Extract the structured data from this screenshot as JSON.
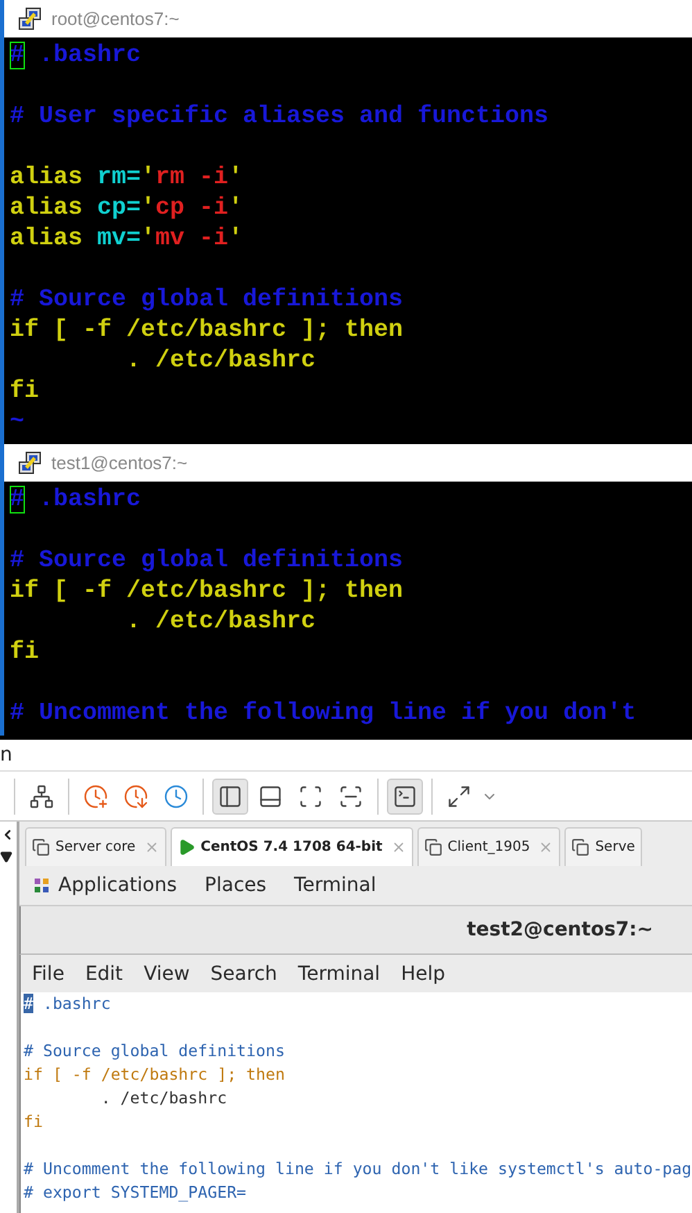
{
  "putty_windows": [
    {
      "title": "root@centos7:~",
      "lines": [
        {
          "kind": "code",
          "tokens": [
            {
              "kind": "cursor",
              "text": "#"
            },
            {
              "kind": "comment",
              "text": " .bashrc"
            }
          ]
        },
        {
          "kind": "blank"
        },
        {
          "kind": "code",
          "tokens": [
            {
              "kind": "comment",
              "text": "# User specific aliases and functions"
            }
          ]
        },
        {
          "kind": "blank"
        },
        {
          "kind": "code",
          "tokens": [
            {
              "kind": "keyword",
              "text": "alias "
            },
            {
              "kind": "variable",
              "text": "rm="
            },
            {
              "kind": "keyword",
              "text": "'"
            },
            {
              "kind": "string",
              "text": "rm -i"
            },
            {
              "kind": "keyword",
              "text": "'"
            }
          ]
        },
        {
          "kind": "code",
          "tokens": [
            {
              "kind": "keyword",
              "text": "alias "
            },
            {
              "kind": "variable",
              "text": "cp="
            },
            {
              "kind": "keyword",
              "text": "'"
            },
            {
              "kind": "string",
              "text": "cp -i"
            },
            {
              "kind": "keyword",
              "text": "'"
            }
          ]
        },
        {
          "kind": "code",
          "tokens": [
            {
              "kind": "keyword",
              "text": "alias "
            },
            {
              "kind": "variable",
              "text": "mv="
            },
            {
              "kind": "keyword",
              "text": "'"
            },
            {
              "kind": "string",
              "text": "mv -i"
            },
            {
              "kind": "keyword",
              "text": "'"
            }
          ]
        },
        {
          "kind": "blank"
        },
        {
          "kind": "code",
          "tokens": [
            {
              "kind": "comment",
              "text": "# Source global definitions"
            }
          ]
        },
        {
          "kind": "code",
          "tokens": [
            {
              "kind": "keyword",
              "text": "if [ -f /etc/bashrc ]; then"
            }
          ]
        },
        {
          "kind": "code",
          "tokens": [
            {
              "kind": "keyword",
              "text": "        . /etc/bashrc"
            }
          ]
        },
        {
          "kind": "code",
          "tokens": [
            {
              "kind": "keyword",
              "text": "fi"
            }
          ]
        },
        {
          "kind": "code",
          "tokens": [
            {
              "kind": "comment",
              "text": "~"
            }
          ]
        }
      ]
    },
    {
      "title": "test1@centos7:~",
      "lines": [
        {
          "kind": "code",
          "tokens": [
            {
              "kind": "cursor",
              "text": "#"
            },
            {
              "kind": "comment",
              "text": " .bashrc"
            }
          ]
        },
        {
          "kind": "blank"
        },
        {
          "kind": "code",
          "tokens": [
            {
              "kind": "comment",
              "text": "# Source global definitions"
            }
          ]
        },
        {
          "kind": "code",
          "tokens": [
            {
              "kind": "keyword",
              "text": "if [ -f /etc/bashrc ]; then"
            }
          ]
        },
        {
          "kind": "code",
          "tokens": [
            {
              "kind": "keyword",
              "text": "        . /etc/bashrc"
            }
          ]
        },
        {
          "kind": "code",
          "tokens": [
            {
              "kind": "keyword",
              "text": "fi"
            }
          ]
        },
        {
          "kind": "blank"
        },
        {
          "kind": "code",
          "tokens": [
            {
              "kind": "comment",
              "text": "# Uncomment the following line if you don't"
            }
          ]
        }
      ]
    }
  ],
  "vm_window": {
    "menu_fragment": "n",
    "toolbar": [
      [
        {
          "kind": "network",
          "selected": false
        }
      ],
      [
        {
          "kind": "take",
          "selected": false
        },
        {
          "kind": "revert",
          "selected": false
        },
        {
          "kind": "manage",
          "selected": false
        }
      ],
      [
        {
          "kind": "sidebar",
          "selected": true
        },
        {
          "kind": "panel",
          "selected": false
        },
        {
          "kind": "fullscreen",
          "selected": false
        },
        {
          "kind": "unity",
          "selected": false
        }
      ],
      [
        {
          "kind": "console",
          "selected": true
        }
      ],
      [
        {
          "kind": "stretch",
          "selected": false
        }
      ]
    ],
    "tabs": [
      {
        "label": "Server core",
        "selected": false
      },
      {
        "label": "CentOS 7.4 1708 64-bit",
        "selected": true
      },
      {
        "label": "Client_1905",
        "selected": false
      },
      {
        "label": "Serve",
        "selected": false
      }
    ],
    "gnome_menu": [
      "Applications",
      "Places",
      "Terminal"
    ],
    "terminal": {
      "title": "test2@centos7:~",
      "menu": [
        "File",
        "Edit",
        "View",
        "Search",
        "Terminal",
        "Help"
      ],
      "lines": [
        {
          "kind": "code",
          "tokens": [
            {
              "kind": "cursor",
              "text": "#"
            },
            {
              "kind": "comment",
              "text": " .bashrc"
            }
          ]
        },
        {
          "kind": "blank"
        },
        {
          "kind": "code",
          "tokens": [
            {
              "kind": "comment",
              "text": "# Source global definitions"
            }
          ]
        },
        {
          "kind": "code",
          "tokens": [
            {
              "kind": "keyword",
              "text": "if [ -f /etc/bashrc ]; then"
            }
          ]
        },
        {
          "kind": "code",
          "tokens": [
            {
              "kind": "plain",
              "text": "        . /etc/bashrc"
            }
          ]
        },
        {
          "kind": "code",
          "tokens": [
            {
              "kind": "keyword",
              "text": "fi"
            }
          ]
        },
        {
          "kind": "blank"
        },
        {
          "kind": "code",
          "tokens": [
            {
              "kind": "comment",
              "text": "# Uncomment the following line if you don't like systemctl's auto-pag"
            }
          ]
        },
        {
          "kind": "code",
          "tokens": [
            {
              "kind": "comment",
              "text": "# export SYSTEMD_PAGER="
            }
          ]
        }
      ]
    }
  }
}
